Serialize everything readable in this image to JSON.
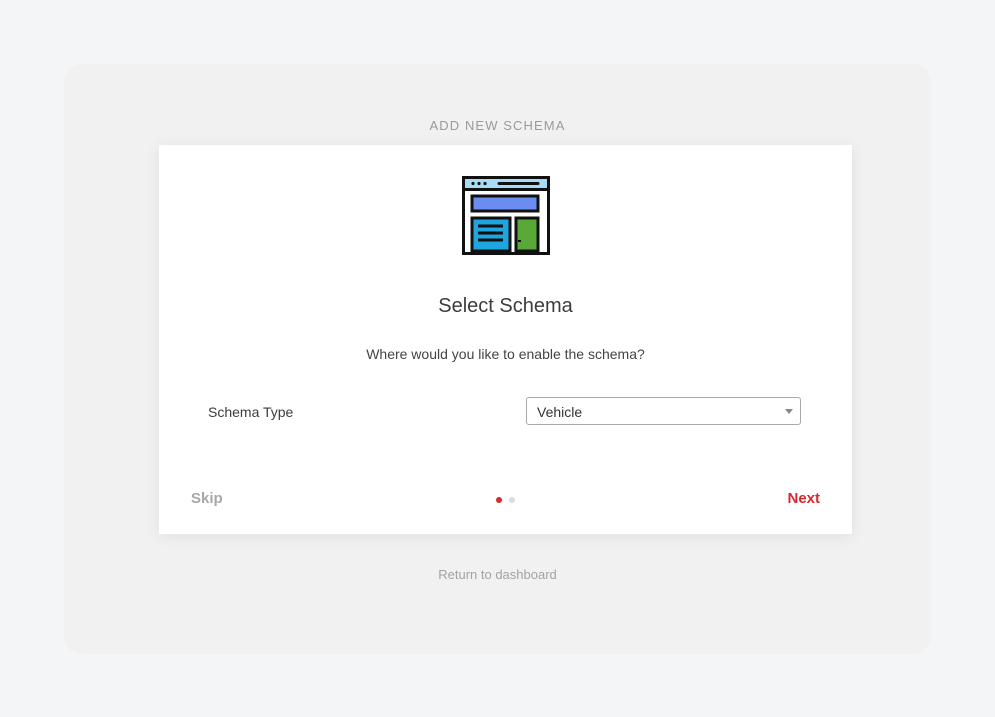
{
  "wizard": {
    "heading": "ADD NEW SCHEMA",
    "return_label": "Return to dashboard"
  },
  "card": {
    "illustration": "schema-webpage-icon",
    "title": "Select Schema",
    "question": "Where would you like to enable the schema?",
    "field_label": "Schema Type",
    "select_value": "Vehicle",
    "skip_label": "Skip",
    "next_label": "Next",
    "step": {
      "current": 1,
      "total": 2
    }
  },
  "colors": {
    "accent": "#d8282c",
    "illustration_header": "#a8dcf5",
    "illustration_banner": "#6b8cf0",
    "illustration_text_block": "#1fa5e0",
    "illustration_sidebar": "#5aa838"
  }
}
